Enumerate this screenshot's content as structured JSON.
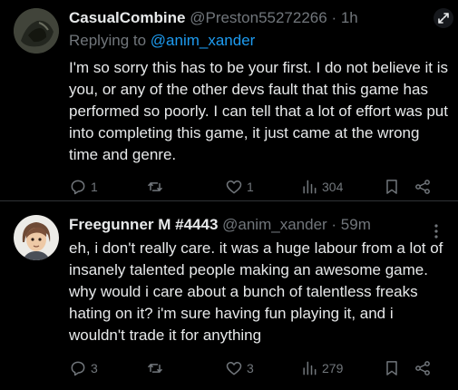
{
  "tweets": [
    {
      "name": "CasualCombine",
      "handle": "@Preston55272266",
      "time": "· 1h",
      "replying_prefix": "Replying to ",
      "replying_to": "@anim_xander",
      "text": "I'm so sorry this has to be your first. I do not believe it is you, or any of the other devs fault that this game has performed so poorly. I can tell that a lot of effort was put into completing this game, it just came at the wrong time and genre.",
      "replies": "1",
      "likes": "1",
      "views": "304"
    },
    {
      "name": "Freegunner M #4443",
      "handle": "@anim_xander",
      "time": "· 59m",
      "text": "eh, i don't really care. it was a huge labour from a lot of insanely talented people making an awesome game. why would i care about a bunch of talentless freaks hating on it? i'm sure having fun playing it, and i wouldn't trade it for anything",
      "replies": "3",
      "likes": "3",
      "views": "279"
    }
  ],
  "icons": {
    "reply": "reply-icon",
    "retweet": "retweet-icon",
    "like": "heart-icon",
    "views": "views-icon",
    "bookmark": "bookmark-icon",
    "share": "share-icon",
    "expand": "expand-icon",
    "more": "more-icon"
  },
  "colors": {
    "background": "#000000",
    "text": "#e7e9ea",
    "muted": "#71767b",
    "link": "#1d9bf0",
    "divider": "#2f3336"
  }
}
